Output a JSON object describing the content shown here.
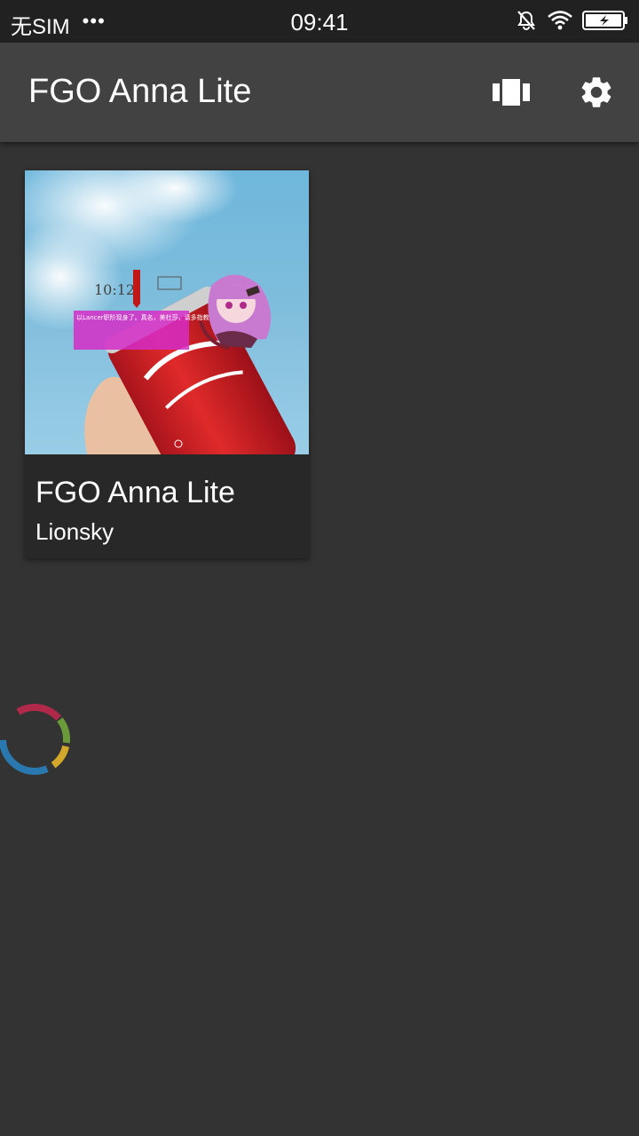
{
  "statusbar": {
    "carrier": "无SIM",
    "dots": "•••",
    "time": "09:41"
  },
  "toolbar": {
    "title": "FGO Anna Lite",
    "icons": [
      "view-carousel-icon",
      "settings-gear-icon"
    ]
  },
  "cards": [
    {
      "title": "FGO Anna Lite",
      "author": "Lionsky",
      "thumbnail": {
        "clock": "10:12",
        "caption": "以Lancer职阶现身了。真名，美杜莎，请多指教。"
      }
    }
  ],
  "colors": {
    "background": "#333333",
    "toolbar": "#424242",
    "statusbar": "#212121",
    "card": "#282828",
    "spinner": [
      "#6a9a3a",
      "#d1a82a",
      "#2a78b0",
      "#b0284a"
    ]
  }
}
